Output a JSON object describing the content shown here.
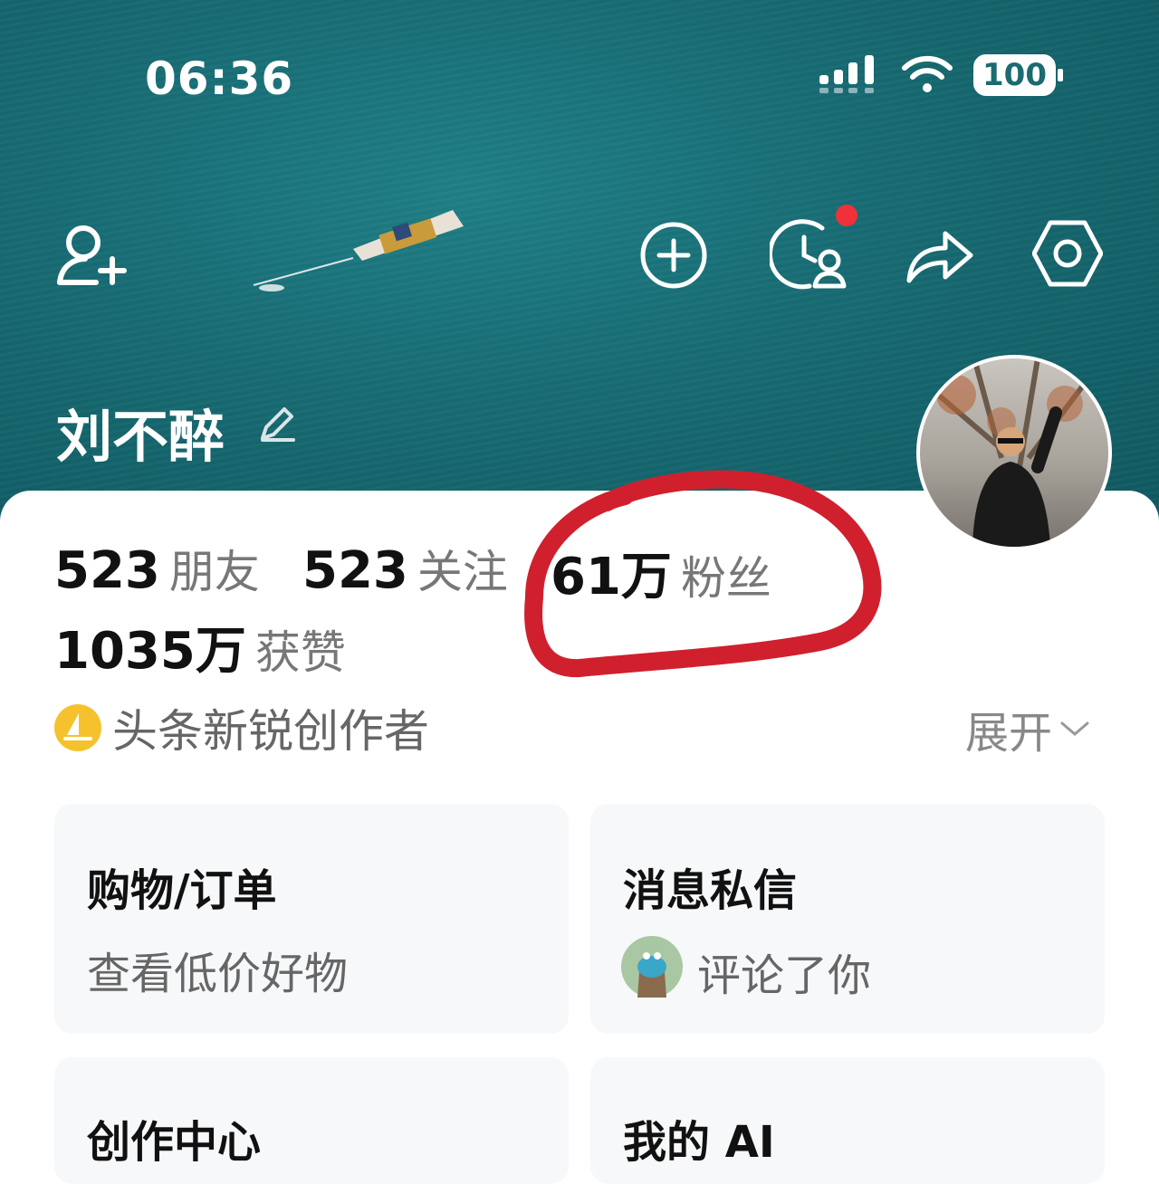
{
  "status_bar": {
    "time": "06:36",
    "battery": "100"
  },
  "profile": {
    "name": "刘不醉"
  },
  "stats": [
    {
      "value": "523",
      "label": "朋友"
    },
    {
      "value": "523",
      "label": "关注"
    },
    {
      "value": "61万",
      "label": "粉丝"
    },
    {
      "value": "1035万",
      "label": "获赞"
    }
  ],
  "badge": {
    "label": "头条新锐创作者"
  },
  "expand": {
    "label": "展开"
  },
  "tiles": [
    {
      "title": "购物/订单",
      "subtitle": "查看低价好物"
    },
    {
      "title": "消息私信",
      "subtitle": "评论了你"
    },
    {
      "title": "创作中心",
      "subtitle": ""
    },
    {
      "title": "我的 AI",
      "subtitle": ""
    }
  ],
  "colors": {
    "hero": "#176a72",
    "accent_red": "#d0202e",
    "notification_dot": "#f0303a",
    "badge_gold": "#f5c22e"
  },
  "icons": [
    "add-friend-icon",
    "plus-circle-icon",
    "history-icon",
    "share-icon",
    "settings-icon",
    "edit-icon",
    "creator-badge-icon",
    "chevron-down-icon"
  ]
}
